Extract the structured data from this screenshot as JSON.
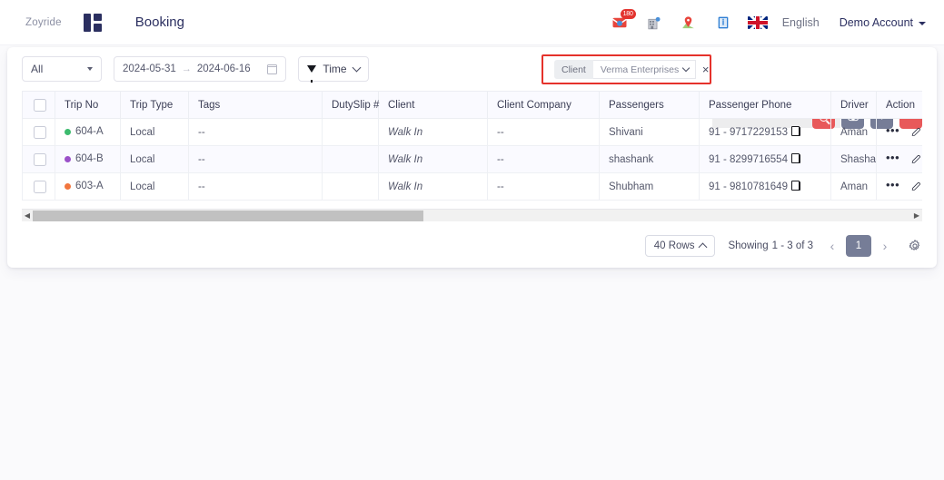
{
  "topbar": {
    "brand": "Zoyride",
    "page_title": "Booking",
    "mail_badge": "180",
    "language": "English",
    "account": "Demo Account",
    "icons": [
      "mail-icon",
      "hotel-icon",
      "map-pin-icon",
      "info-book-icon",
      "uk-flag-icon"
    ]
  },
  "toolbar": {
    "scope_filter": "All",
    "date_from": "2024-05-31",
    "date_to": "2024-06-16",
    "date_arrow": "→",
    "time_filter": "Time",
    "client_label": "Client",
    "client_value": "Verma Enterprises",
    "client_clear": "×",
    "search_value": "",
    "search_placeholder": "",
    "buttons": {
      "search": "search-icon",
      "download": "download-cloud-icon",
      "add": "+",
      "more": "•••"
    }
  },
  "table": {
    "columns": [
      "Trip No",
      "Trip Type",
      "Tags",
      "DutySlip #",
      "Client",
      "Client Company",
      "Passengers",
      "Passenger Phone",
      "Driver",
      "Action"
    ],
    "rows": [
      {
        "status_color": "#3dbb6e",
        "trip_no": "604-A",
        "trip_type": "Local",
        "tags": "--",
        "dutyslip": "",
        "client": "Walk In",
        "client_company": "--",
        "passengers": "Shivani",
        "passenger_phone": "91 - 9717229153",
        "driver": "Aman"
      },
      {
        "status_color": "#9b51c9",
        "trip_no": "604-B",
        "trip_type": "Local",
        "tags": "--",
        "dutyslip": "",
        "client": "Walk In",
        "client_company": "--",
        "passengers": "shashank",
        "passenger_phone": "91 - 8299716554",
        "driver": "Shashank"
      },
      {
        "status_color": "#f2763e",
        "trip_no": "603-A",
        "trip_type": "Local",
        "tags": "--",
        "dutyslip": "",
        "client": "Walk In",
        "client_company": "--",
        "passengers": "Shubham",
        "passenger_phone": "91 - 9810781649",
        "driver": "Aman"
      }
    ]
  },
  "footer": {
    "rows_per_page": "40 Rows",
    "showing_label": "Showing",
    "showing_range": "1 - 3 of 3",
    "prev": "‹",
    "next": "›",
    "current_page": "1",
    "settings_icon": "gear-icon"
  },
  "colors": {
    "accent_red": "#e8595a",
    "slate": "#767d97",
    "highlight_border": "#e5322b",
    "brand_navy": "#2b2f60"
  }
}
